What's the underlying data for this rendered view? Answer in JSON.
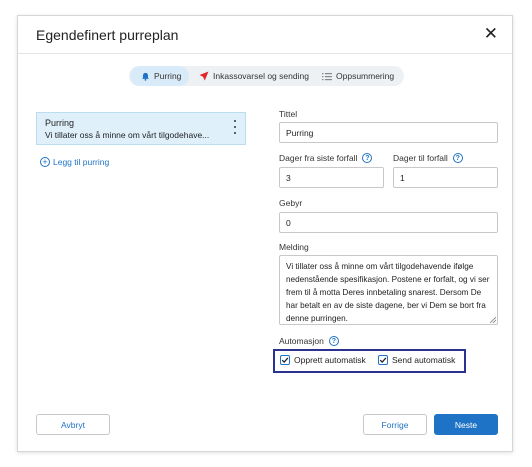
{
  "dialog": {
    "title": "Egendefinert purreplan",
    "close_glyph": "✕"
  },
  "stepper": {
    "steps": [
      {
        "label": "Purring",
        "icon": "bell-icon",
        "active": true
      },
      {
        "label": "Inkassovarsel og sending",
        "icon": "send-icon",
        "active": false
      },
      {
        "label": "Oppsummering",
        "icon": "list-icon",
        "active": false
      }
    ]
  },
  "left": {
    "item": {
      "title": "Purring",
      "text": "Vi tillater oss å minne om vårt tilgodehave..."
    },
    "add_label": "Legg til purring"
  },
  "form": {
    "tittel_label": "Tittel",
    "tittel_value": "Purring",
    "dager_siste_label": "Dager fra siste forfall",
    "dager_siste_value": "3",
    "dager_til_label": "Dager til forfall",
    "dager_til_value": "1",
    "gebyr_label": "Gebyr",
    "gebyr_value": "0",
    "melding_label": "Melding",
    "melding_lines": [
      "Vi tillater oss å minne om vårt tilgodehavende ifølge",
      "nedenstående spesifikasjon. Postene er forfalt, og vi ser",
      "frem til å motta Deres innbetaling snarest. Dersom De",
      "har betalt en av de siste dagene, ber vi Dem se bort fra",
      "denne purringen."
    ],
    "automasjon_label": "Automasjon",
    "opprett_label": "Opprett automatisk",
    "opprett_checked": true,
    "send_label": "Send automatisk",
    "send_checked": true
  },
  "footer": {
    "cancel": "Avbryt",
    "prev": "Forrige",
    "next": "Neste"
  },
  "colors": {
    "accent": "#1f73c6",
    "highlight": "#2b3190",
    "send_icon": "#e0242b",
    "active_step": "#d9ebf8"
  }
}
